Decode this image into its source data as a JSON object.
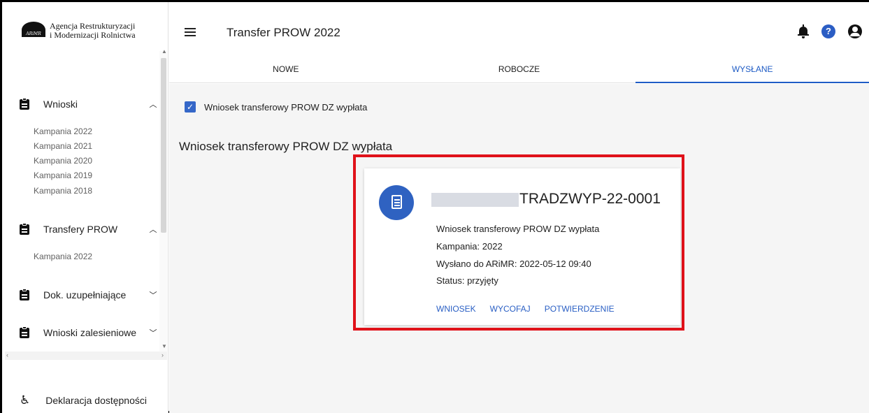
{
  "brand": {
    "name_line1": "Agencja Restrukturyzacji",
    "name_line2": "i Modernizacji Rolnictwa",
    "logo_abbr": "ARiMR"
  },
  "header": {
    "title": "Transfer PROW 2022",
    "icons": [
      "menu-icon",
      "bell-icon",
      "help-icon",
      "account-icon"
    ],
    "help_glyph": "?"
  },
  "tabs": [
    {
      "label": "NOWE",
      "active": false
    },
    {
      "label": "ROBOCZE",
      "active": false
    },
    {
      "label": "WYSŁANE",
      "active": true
    }
  ],
  "sidebar": {
    "sections": [
      {
        "label": "Wnioski",
        "expanded": true,
        "items": [
          "Kampania 2022",
          "Kampania 2021",
          "Kampania 2020",
          "Kampania 2019",
          "Kampania 2018"
        ]
      },
      {
        "label": "Transfery PROW",
        "expanded": true,
        "items": [
          "Kampania 2022"
        ]
      },
      {
        "label": "Dok. uzupełniające",
        "expanded": false,
        "items": []
      },
      {
        "label": "Wnioski zalesieniowe",
        "expanded": false,
        "items": []
      }
    ],
    "footer_link": "Deklaracja dostępności"
  },
  "filter": {
    "checked": true,
    "label": "Wniosek transferowy PROW DZ wypłata"
  },
  "section_title": "Wniosek transferowy PROW DZ wypłata",
  "card": {
    "id": "TRADZWYP-22-0001",
    "type": "Wniosek transferowy PROW DZ wypłata",
    "campaign": "Kampania: 2022",
    "sent": "Wysłano do ARiMR: 2022-05-12 09:40",
    "status": "Status: przyjęty",
    "actions": [
      "WNIOSEK",
      "WYCOFAJ",
      "POTWIERDZENIE"
    ]
  },
  "colors": {
    "accent": "#1f5cc5",
    "highlight": "#e0121a",
    "background": "#f5f5f5"
  }
}
